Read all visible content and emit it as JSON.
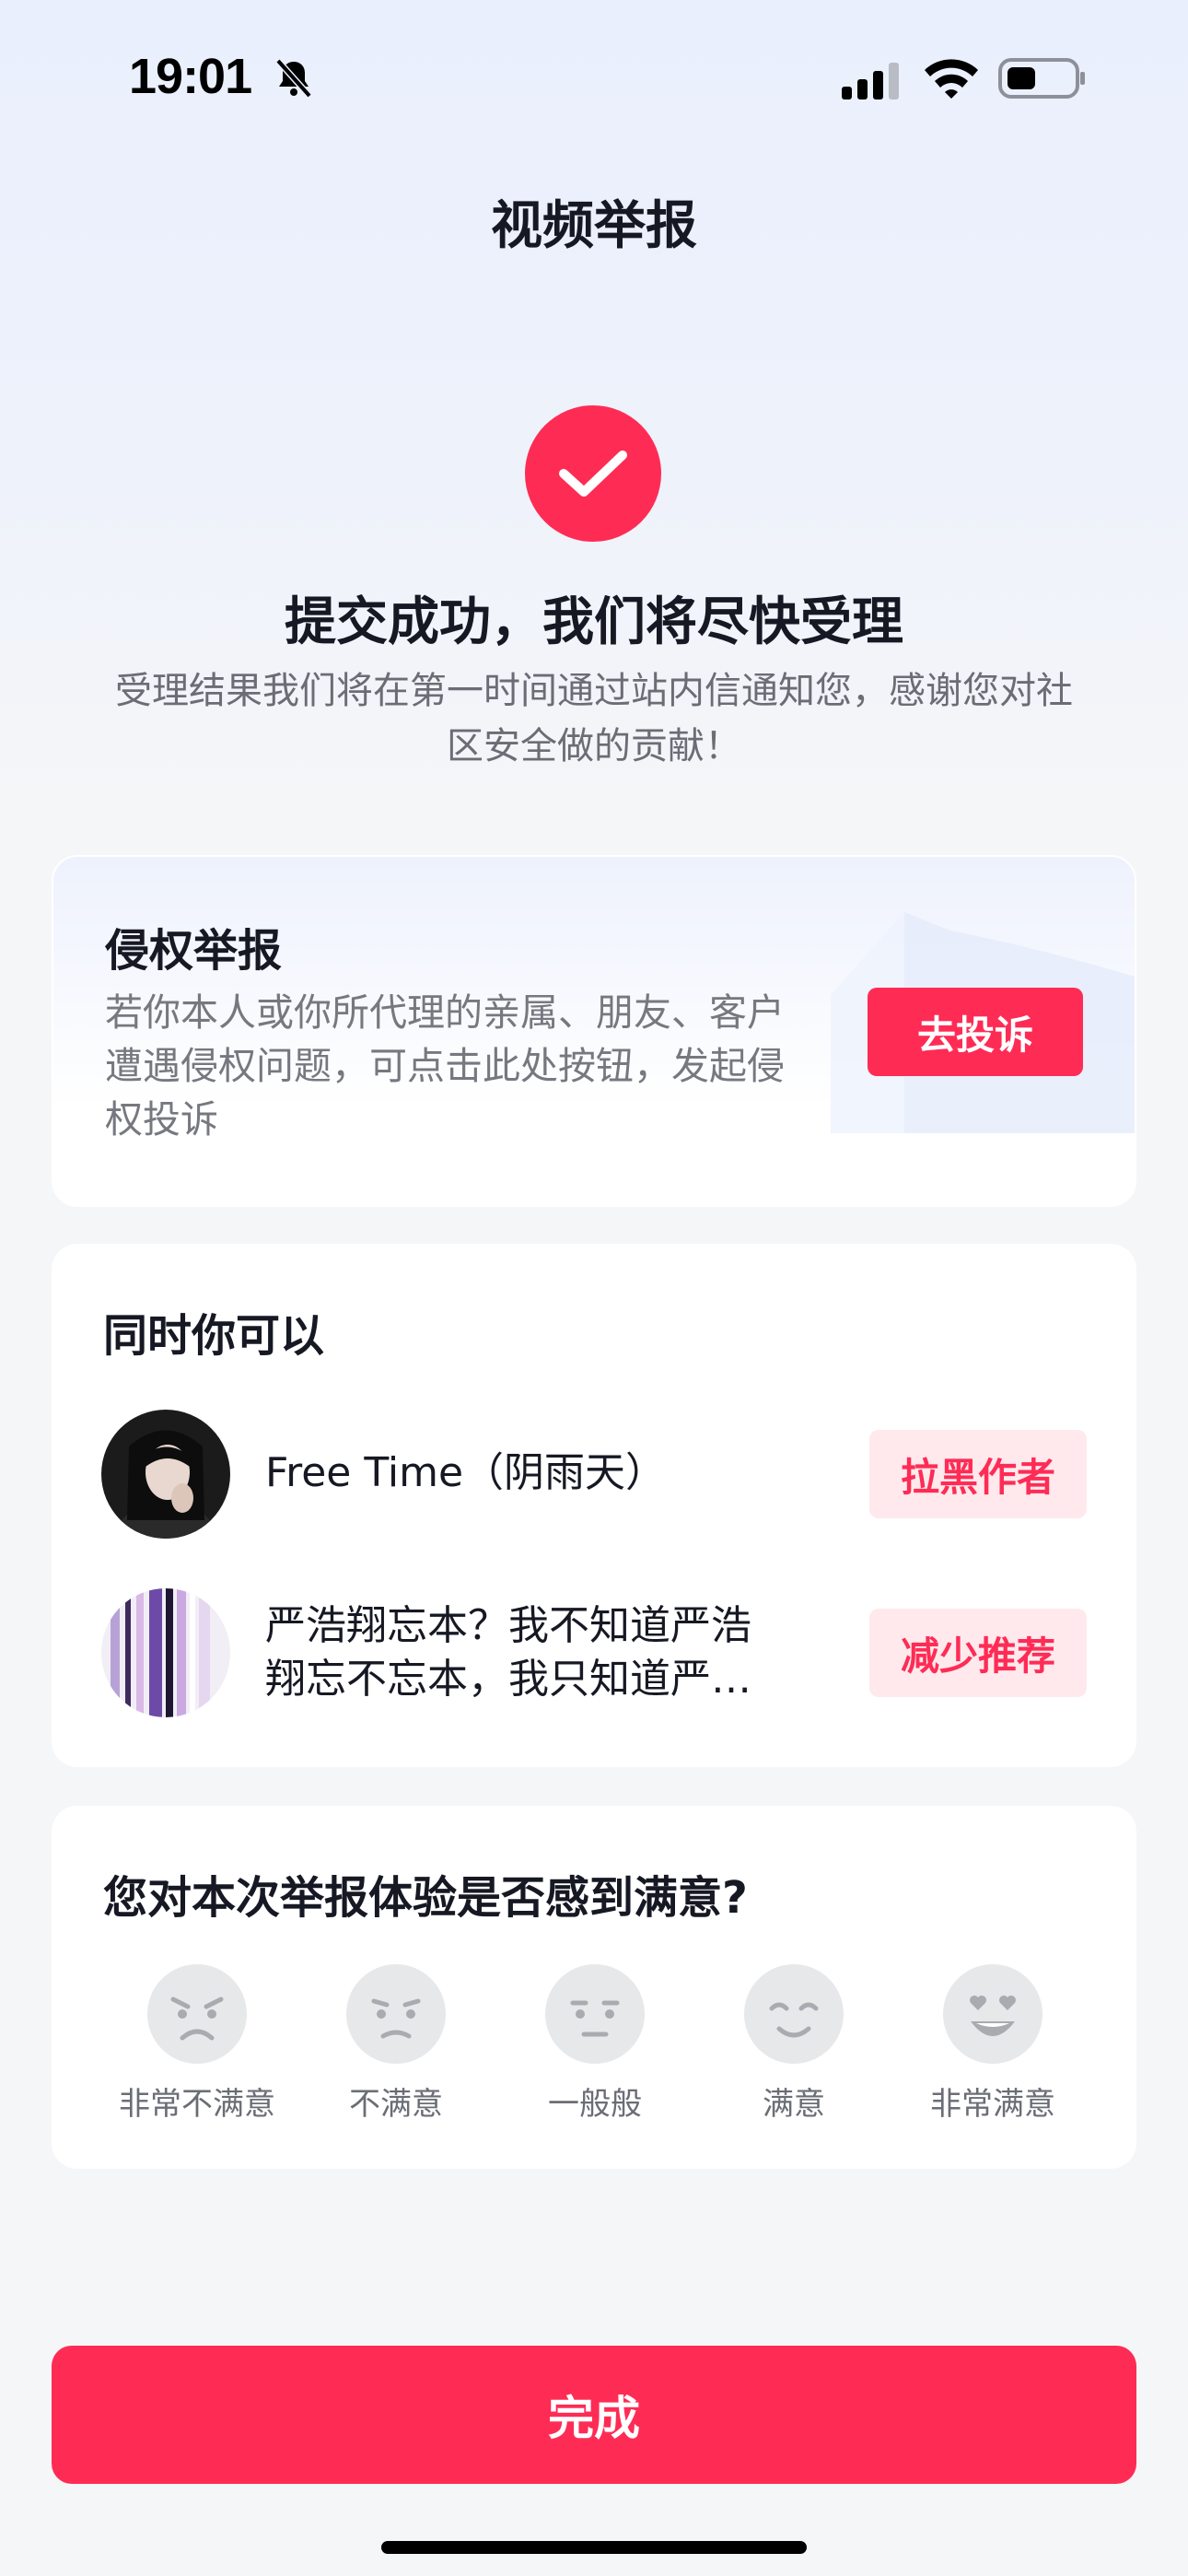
{
  "status_bar": {
    "time": "19:01",
    "icons": [
      "bell-slash-icon",
      "signal-icon",
      "wifi-icon",
      "battery-icon"
    ]
  },
  "header": {
    "title": "视频举报"
  },
  "success": {
    "icon": "checkmark-icon",
    "title": "提交成功，我们将尽快受理",
    "description": "受理结果我们将在第一时间通过站内信通知您，感谢您对社区安全做的贡献！"
  },
  "infringement_card": {
    "title": "侵权举报",
    "description": "若你本人或你所代理的亲属、朋友、客户遭遇侵权问题，可点击此处按钮，发起侵权投诉",
    "button_label": "去投诉"
  },
  "actions_card": {
    "title": "同时你可以",
    "items": [
      {
        "text": "Free Time（阴雨天）",
        "button_label": "拉黑作者"
      },
      {
        "text_line1": "严浩翔忘本？我不知道严浩",
        "text_line2": "翔忘不忘本，我只知道严…",
        "button_label": "减少推荐"
      }
    ]
  },
  "feedback_card": {
    "title": "您对本次举报体验是否感到满意?",
    "options": [
      {
        "label": "非常不满意",
        "icon": "very-unsatisfied-face-icon"
      },
      {
        "label": "不满意",
        "icon": "unsatisfied-face-icon"
      },
      {
        "label": "一般般",
        "icon": "neutral-face-icon"
      },
      {
        "label": "满意",
        "icon": "satisfied-face-icon"
      },
      {
        "label": "非常满意",
        "icon": "very-satisfied-face-icon"
      }
    ]
  },
  "footer": {
    "done_label": "完成"
  },
  "colors": {
    "accent": "#fe2c55",
    "accent_light": "#ffe9ed",
    "text_primary": "#161823",
    "text_secondary": "#6b6d76"
  }
}
